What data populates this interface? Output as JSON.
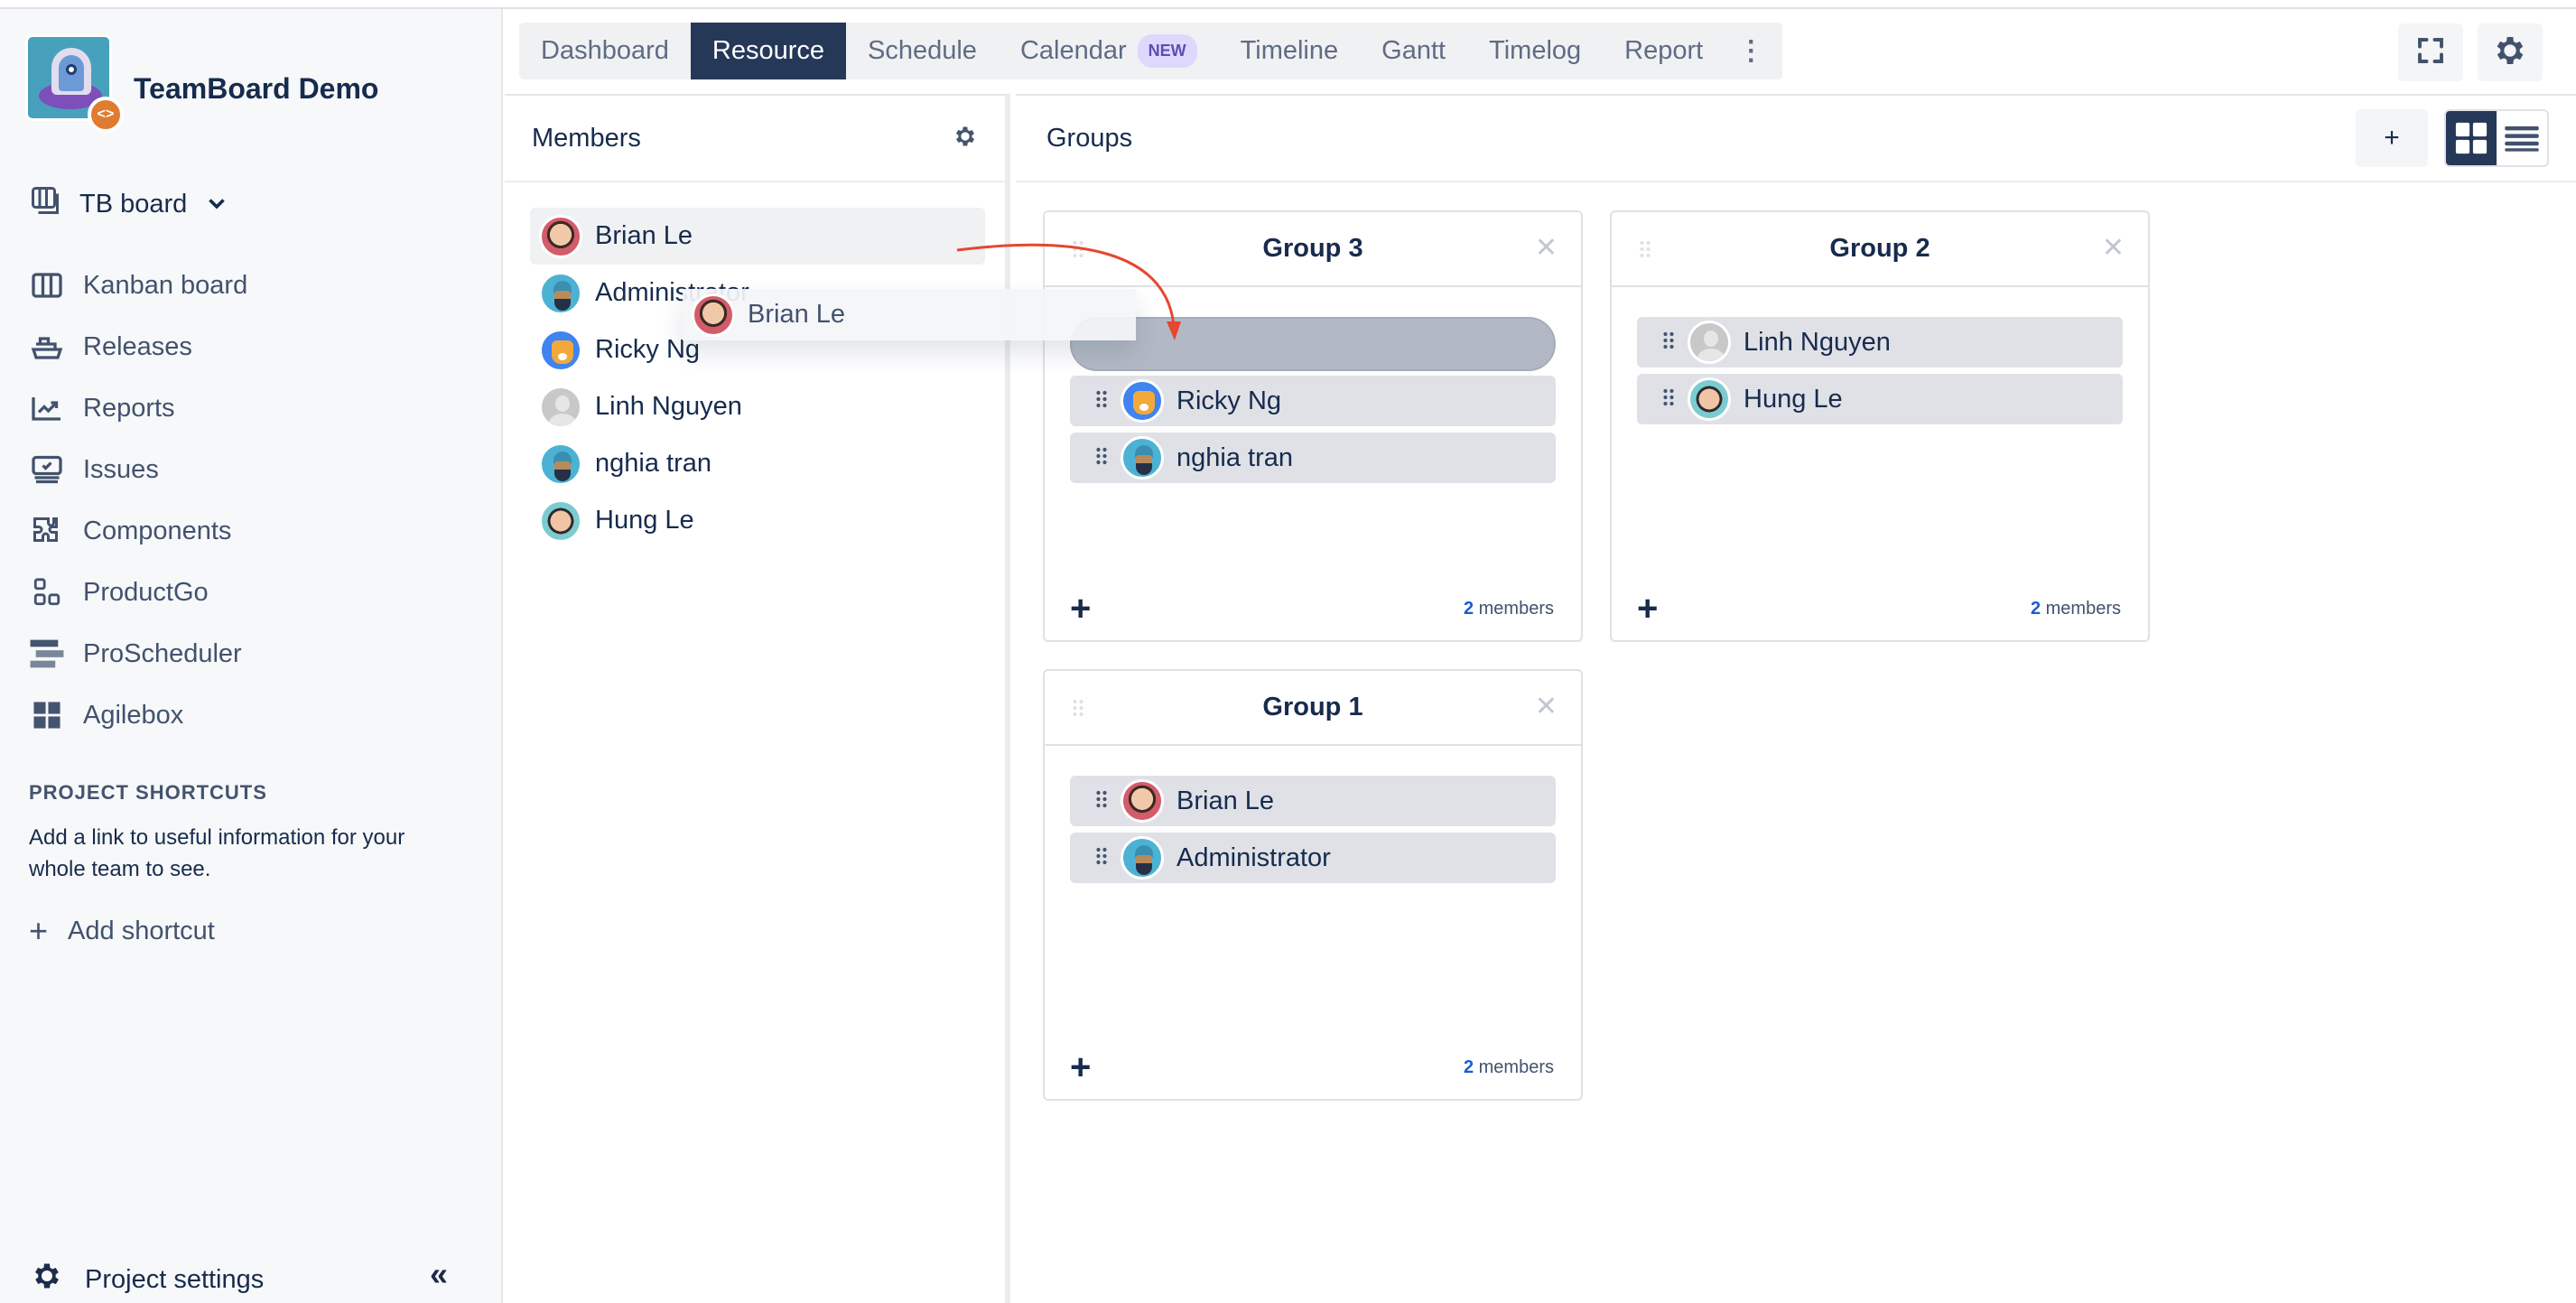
{
  "app": {
    "title": "TeamBoard Demo",
    "board_selector": "TB board"
  },
  "sidebar": {
    "items": [
      {
        "label": "Kanban board",
        "icon": "kanban-board-icon"
      },
      {
        "label": "Releases",
        "icon": "ship-icon"
      },
      {
        "label": "Reports",
        "icon": "line-chart-icon"
      },
      {
        "label": "Issues",
        "icon": "issues-icon"
      },
      {
        "label": "Components",
        "icon": "puzzle-icon"
      },
      {
        "label": "ProductGo",
        "icon": "productgo-icon"
      },
      {
        "label": "ProScheduler",
        "icon": "proscheduler-icon"
      },
      {
        "label": "Agilebox",
        "icon": "agilebox-icon"
      }
    ],
    "shortcuts_heading": "PROJECT SHORTCUTS",
    "shortcuts_text": "Add a link to useful information for your whole team to see.",
    "add_shortcut": "Add shortcut",
    "project_settings": "Project settings"
  },
  "tabs": [
    {
      "label": "Dashboard",
      "active": false
    },
    {
      "label": "Resource",
      "active": true
    },
    {
      "label": "Schedule",
      "active": false
    },
    {
      "label": "Calendar",
      "active": false,
      "badge": "NEW"
    },
    {
      "label": "Timeline",
      "active": false
    },
    {
      "label": "Gantt",
      "active": false
    },
    {
      "label": "Timelog",
      "active": false
    },
    {
      "label": "Report",
      "active": false
    }
  ],
  "members_panel": {
    "title": "Members",
    "members": [
      {
        "name": "Brian Le",
        "avatar": "brian"
      },
      {
        "name": "Administrator",
        "avatar": "admin"
      },
      {
        "name": "Ricky Ng",
        "avatar": "ricky"
      },
      {
        "name": "Linh Nguyen",
        "avatar": "linh"
      },
      {
        "name": "nghia tran",
        "avatar": "admin"
      },
      {
        "name": "Hung Le",
        "avatar": "hung"
      }
    ],
    "drag_ghost": "Brian Le"
  },
  "groups_panel": {
    "title": "Groups",
    "add_label": "+",
    "groups": [
      {
        "title": "Group 3",
        "members": [
          {
            "name": "Ricky Ng",
            "avatar": "ricky"
          },
          {
            "name": "nghia tran",
            "avatar": "admin"
          }
        ],
        "count": "2",
        "count_label": "members",
        "drop_placeholder": true
      },
      {
        "title": "Group 2",
        "members": [
          {
            "name": "Linh Nguyen",
            "avatar": "linh"
          },
          {
            "name": "Hung Le",
            "avatar": "hung"
          }
        ],
        "count": "2",
        "count_label": "members"
      },
      {
        "title": "Group 1",
        "members": [
          {
            "name": "Brian Le",
            "avatar": "brian"
          },
          {
            "name": "Administrator",
            "avatar": "admin"
          }
        ],
        "count": "2",
        "count_label": "members"
      }
    ]
  },
  "colors": {
    "accent_dark": "#253858",
    "drag_arrow": "#e5472f",
    "count_blue": "#1d5bd6",
    "new_badge_bg": "#dfd8fd"
  }
}
